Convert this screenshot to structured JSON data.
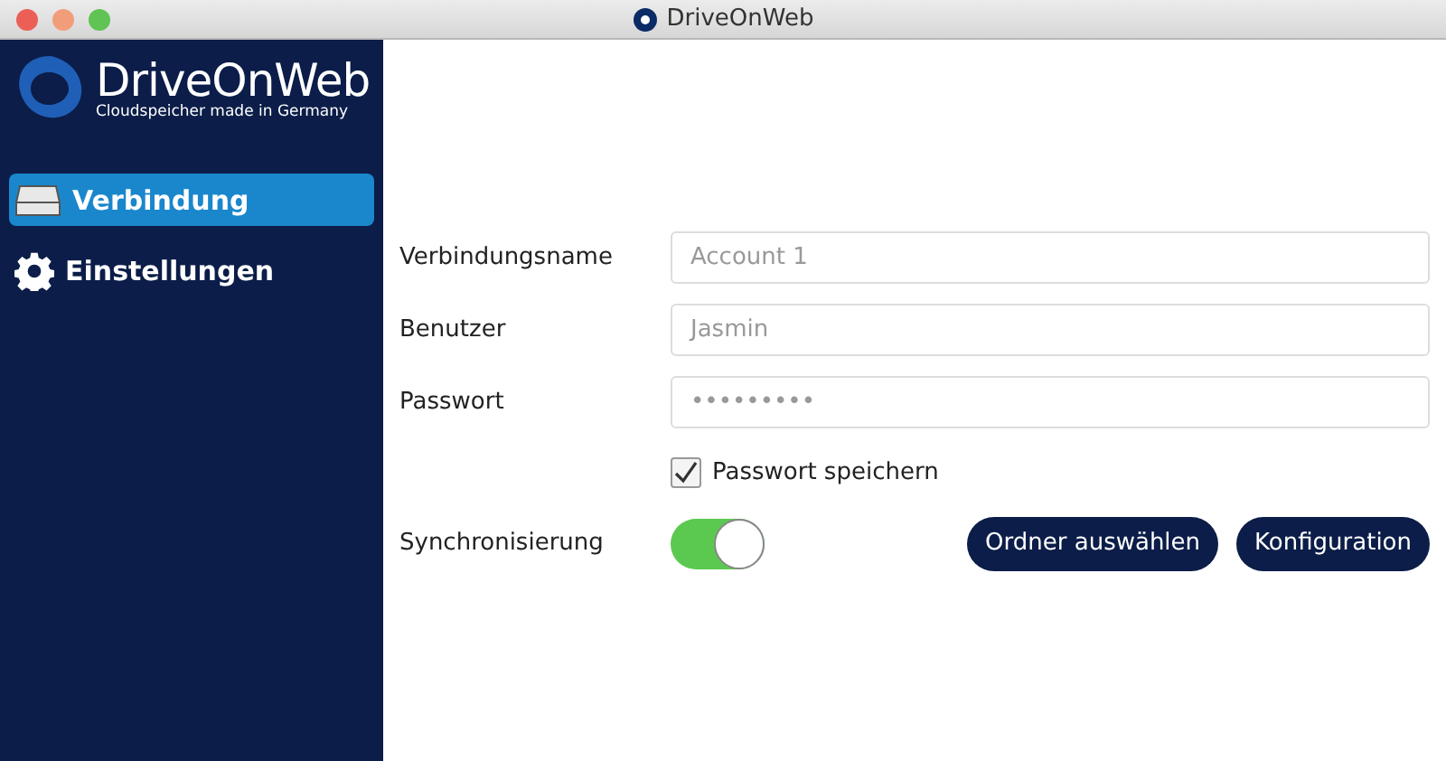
{
  "window": {
    "title": "DriveOnWeb"
  },
  "logo": {
    "name": "DriveOnWeb",
    "tagline": "Cloudspeicher made in Germany"
  },
  "sidebar": {
    "items": [
      {
        "label": "Verbindung",
        "kind": "drive",
        "selected": true
      },
      {
        "label": "Einstellungen",
        "kind": "gear",
        "selected": false
      }
    ]
  },
  "form": {
    "fields": [
      {
        "label": "Verbindungsname",
        "value": "Account 1"
      },
      {
        "label": "Benutzer",
        "value": "Jasmin"
      },
      {
        "label": "Passwort",
        "value": "•••••••••"
      }
    ],
    "save_password": {
      "label": "Passwort speichern",
      "checked": true
    },
    "sync": {
      "label": "Synchronisierung",
      "on": true
    },
    "buttons": [
      "Ordner auswählen",
      "Konfiguration"
    ]
  }
}
